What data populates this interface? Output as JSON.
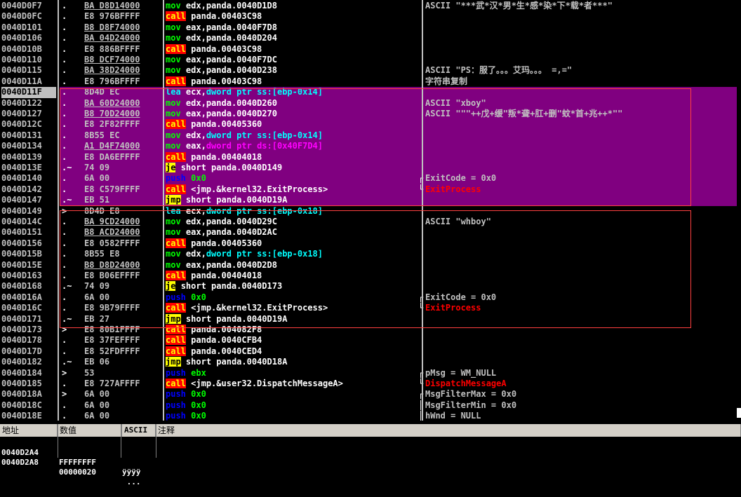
{
  "rows": [
    {
      "addr": "0040D0F7",
      "mark": ".",
      "hex": "BA D8D14000",
      "op": "mov",
      "args": [
        [
          "edx,panda.0040D1D8",
          "reg"
        ]
      ],
      "comment": "ASCII \"***武*汉*男*生*感*染*下*载*者***\""
    },
    {
      "addr": "0040D0FC",
      "mark": ".",
      "hex": "E8 976BFFFF",
      "op": "call",
      "args": [
        [
          "panda.00403C98",
          "reg"
        ]
      ],
      "comment": ""
    },
    {
      "addr": "0040D101",
      "mark": ".",
      "hex": "B8 D8F74000",
      "op": "mov",
      "args": [
        [
          "eax,panda.0040F7D8",
          "reg"
        ]
      ],
      "comment": ""
    },
    {
      "addr": "0040D106",
      "mark": ".",
      "hex": "BA 04D24000",
      "op": "mov",
      "args": [
        [
          "edx,panda.0040D204",
          "reg"
        ]
      ],
      "comment": ""
    },
    {
      "addr": "0040D10B",
      "mark": ".",
      "hex": "E8 886BFFFF",
      "op": "call",
      "args": [
        [
          "panda.00403C98",
          "reg"
        ]
      ],
      "comment": ""
    },
    {
      "addr": "0040D110",
      "mark": ".",
      "hex": "B8 DCF74000",
      "op": "mov",
      "args": [
        [
          "eax,panda.0040F7DC",
          "reg"
        ]
      ],
      "comment": ""
    },
    {
      "addr": "0040D115",
      "mark": ".",
      "hex": "BA 38D24000",
      "op": "mov",
      "args": [
        [
          "edx,panda.0040D238",
          "reg"
        ]
      ],
      "comment": "ASCII \"PS：服了。。。艾玛。。。 =,=\""
    },
    {
      "addr": "0040D11A",
      "mark": ".",
      "hex": "E8 796BFFFF",
      "op": "call",
      "args": [
        [
          "panda.00403C98",
          "reg"
        ]
      ],
      "comment": "字符串复制"
    },
    {
      "addr": "0040D11F",
      "mark": ".",
      "hex": "8D4D EC",
      "op": "lea",
      "args": [
        [
          "ecx,",
          "reg"
        ],
        [
          "dword ptr ss:[ebp-0x14]",
          "mem"
        ]
      ],
      "comment": ""
    },
    {
      "addr": "0040D122",
      "mark": ".",
      "hex": "BA 60D24000",
      "op": "mov",
      "args": [
        [
          "edx,panda.0040D260",
          "reg"
        ]
      ],
      "comment": "ASCII \"xboy\""
    },
    {
      "addr": "0040D127",
      "mark": ".",
      "hex": "B8 70D24000",
      "op": "mov",
      "args": [
        [
          "eax,panda.0040D270",
          "reg"
        ]
      ],
      "comment": "ASCII \"\"\"++戊+缓\"叛*聋+肛+删\"蚊*首+兆++*\"\""
    },
    {
      "addr": "0040D12C",
      "mark": ".",
      "hex": "E8 2F82FFFF",
      "op": "call",
      "args": [
        [
          "panda.00405360",
          "reg"
        ]
      ],
      "comment": ""
    },
    {
      "addr": "0040D131",
      "mark": ".",
      "hex": "8B55 EC",
      "op": "mov",
      "args": [
        [
          "edx,",
          "reg"
        ],
        [
          "dword ptr ss:[ebp-0x14]",
          "mem"
        ]
      ],
      "comment": ""
    },
    {
      "addr": "0040D134",
      "mark": ".",
      "hex": "A1 D4F74000",
      "op": "mov",
      "args": [
        [
          "eax,",
          "reg"
        ],
        [
          "dword ptr ds:[0x40F7D4]",
          "mem2"
        ]
      ],
      "comment": ""
    },
    {
      "addr": "0040D139",
      "mark": ".",
      "hex": "E8 DA6EFFFF",
      "op": "call",
      "args": [
        [
          "panda.00404018",
          "reg"
        ]
      ],
      "comment": ""
    },
    {
      "addr": "0040D13E",
      "mark": ".~",
      "hex": "74 09",
      "op": "je",
      "args": [
        [
          "short panda.0040D149",
          "reg"
        ]
      ],
      "comment": ""
    },
    {
      "addr": "0040D140",
      "mark": ".",
      "hex": "6A 00",
      "op": "push",
      "args": [
        [
          "0x0",
          "imm"
        ]
      ],
      "comment": "ExitCode = 0x0",
      "bracket": "┌"
    },
    {
      "addr": "0040D142",
      "mark": ".",
      "hex": "E8 C579FFFF",
      "op": "call",
      "args": [
        [
          "<jmp.&kernel32.ExitProcess>",
          "reg"
        ]
      ],
      "comment": "ExitProcess",
      "cred": true,
      "bracket": "└"
    },
    {
      "addr": "0040D147",
      "mark": ".~",
      "hex": "EB 51",
      "op": "jmp",
      "args": [
        [
          "short panda.0040D19A",
          "reg"
        ]
      ],
      "comment": ""
    },
    {
      "addr": "0040D149",
      "mark": ">",
      "hex": "8D4D E8",
      "op": "lea",
      "args": [
        [
          "ecx,",
          "reg"
        ],
        [
          "dword ptr ss:[ebp-0x18]",
          "mem"
        ]
      ],
      "comment": ""
    },
    {
      "addr": "0040D14C",
      "mark": ".",
      "hex": "BA 9CD24000",
      "op": "mov",
      "args": [
        [
          "edx,panda.0040D29C",
          "reg"
        ]
      ],
      "comment": "ASCII \"whboy\""
    },
    {
      "addr": "0040D151",
      "mark": ".",
      "hex": "B8 ACD24000",
      "op": "mov",
      "args": [
        [
          "eax,panda.0040D2AC",
          "reg"
        ]
      ],
      "comment": ""
    },
    {
      "addr": "0040D156",
      "mark": ".",
      "hex": "E8 0582FFFF",
      "op": "call",
      "args": [
        [
          "panda.00405360",
          "reg"
        ]
      ],
      "comment": ""
    },
    {
      "addr": "0040D15B",
      "mark": ".",
      "hex": "8B55 E8",
      "op": "mov",
      "args": [
        [
          "edx,",
          "reg"
        ],
        [
          "dword ptr ss:[ebp-0x18]",
          "mem"
        ]
      ],
      "comment": ""
    },
    {
      "addr": "0040D15E",
      "mark": ".",
      "hex": "B8 D8D24000",
      "op": "mov",
      "args": [
        [
          "eax,panda.0040D2D8",
          "reg"
        ]
      ],
      "comment": ""
    },
    {
      "addr": "0040D163",
      "mark": ".",
      "hex": "E8 B06EFFFF",
      "op": "call",
      "args": [
        [
          "panda.00404018",
          "reg"
        ]
      ],
      "comment": ""
    },
    {
      "addr": "0040D168",
      "mark": ".~",
      "hex": "74 09",
      "op": "je",
      "args": [
        [
          "short panda.0040D173",
          "reg"
        ]
      ],
      "comment": ""
    },
    {
      "addr": "0040D16A",
      "mark": ".",
      "hex": "6A 00",
      "op": "push",
      "args": [
        [
          "0x0",
          "imm"
        ]
      ],
      "comment": "ExitCode = 0x0",
      "bracket": "┌"
    },
    {
      "addr": "0040D16C",
      "mark": ".",
      "hex": "E8 9B79FFFF",
      "op": "call",
      "args": [
        [
          "<jmp.&kernel32.ExitProcess>",
          "reg"
        ]
      ],
      "comment": "ExitProcess",
      "cred": true,
      "bracket": "└"
    },
    {
      "addr": "0040D171",
      "mark": ".~",
      "hex": "EB 27",
      "op": "jmp",
      "args": [
        [
          "short panda.0040D19A",
          "reg"
        ]
      ],
      "comment": ""
    },
    {
      "addr": "0040D173",
      "mark": ">",
      "hex": "E8 80B1FFFF",
      "op": "call",
      "args": [
        [
          "panda.004082F8",
          "reg"
        ]
      ],
      "comment": ""
    },
    {
      "addr": "0040D178",
      "mark": ".",
      "hex": "E8 37FEFFFF",
      "op": "call",
      "args": [
        [
          "panda.0040CFB4",
          "reg"
        ]
      ],
      "comment": ""
    },
    {
      "addr": "0040D17D",
      "mark": ".",
      "hex": "E8 52FDFFFF",
      "op": "call",
      "args": [
        [
          "panda.0040CED4",
          "reg"
        ]
      ],
      "comment": ""
    },
    {
      "addr": "0040D182",
      "mark": ".~",
      "hex": "EB 06",
      "op": "jmp",
      "args": [
        [
          "short panda.0040D18A",
          "reg"
        ]
      ],
      "comment": ""
    },
    {
      "addr": "0040D184",
      "mark": ">",
      "hex": "53",
      "op": "push",
      "args": [
        [
          "ebx",
          "imm"
        ]
      ],
      "comment": "pMsg = WM_NULL",
      "bracket": "┌"
    },
    {
      "addr": "0040D185",
      "mark": ".",
      "hex": "E8 727AFFFF",
      "op": "call",
      "args": [
        [
          "<jmp.&user32.DispatchMessageA>",
          "reg"
        ]
      ],
      "comment": "DispatchMessageA",
      "cred": true,
      "bracket": "└"
    },
    {
      "addr": "0040D18A",
      "mark": ">",
      "hex": "6A 00",
      "op": "push",
      "args": [
        [
          "0x0",
          "imm"
        ]
      ],
      "comment": "MsgFilterMax = 0x0",
      "bracket": "┌"
    },
    {
      "addr": "0040D18C",
      "mark": ".",
      "hex": "6A 00",
      "op": "push",
      "args": [
        [
          "0x0",
          "imm"
        ]
      ],
      "comment": "MsgFilterMin = 0x0",
      "bracket": "│"
    },
    {
      "addr": "0040D18E",
      "mark": ".",
      "hex": "6A 00",
      "op": "push",
      "args": [
        [
          "0x0",
          "imm"
        ]
      ],
      "comment": "hWnd = NULL",
      "bracket": "│"
    }
  ],
  "current_row": 8,
  "highlight_rows": [
    8,
    9,
    10,
    11,
    12,
    13,
    14,
    15,
    16,
    17,
    18
  ],
  "underline_hex": [
    0,
    2,
    3,
    5,
    6,
    9,
    10,
    13,
    20,
    21,
    24
  ],
  "dump": {
    "headers": [
      "地址",
      "数值",
      "ASCII",
      "注释"
    ],
    "rows": [
      {
        "addr": "0040D2A4",
        "value": "FFFFFFFF",
        "ascii": "ÿÿÿÿ"
      },
      {
        "addr": "0040D2A8",
        "value": "00000020",
        "ascii": " ..."
      }
    ]
  },
  "colors": {
    "highlight": "#800080",
    "box": "#ff4040",
    "background": "#000000"
  }
}
